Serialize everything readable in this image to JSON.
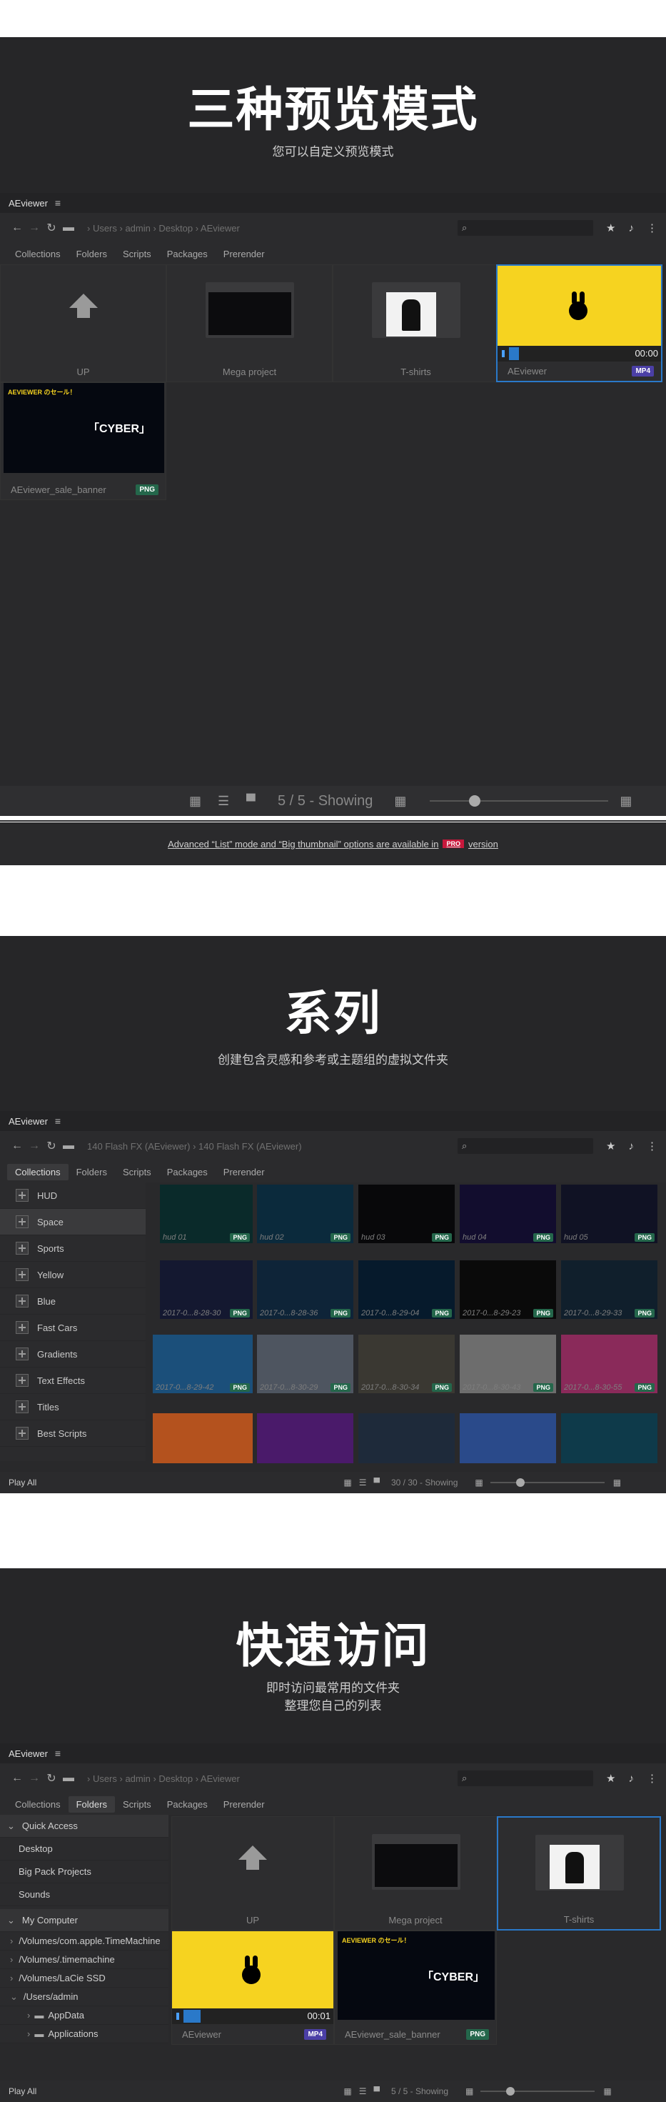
{
  "section1": {
    "title": "三种预览模式",
    "subtitle": "您可以自定义预览模式",
    "app_title": "AEviewer",
    "nav_crumbs": "›  Users  ›  admin  ›  Desktop  ›  AEviewer",
    "tabs": [
      "Collections",
      "Folders",
      "Scripts",
      "Packages",
      "Prerender"
    ],
    "cards": [
      {
        "label": "UP"
      },
      {
        "label": "Mega project"
      },
      {
        "label": "T-shirts"
      },
      {
        "label": "AEviewer",
        "badge": "MP4",
        "time": "00:00"
      },
      {
        "label": "AEviewer_sale_banner",
        "badge": "PNG"
      }
    ],
    "banner_text": "AEVIEWER のセール！",
    "banner_big": "「CYBER」",
    "status": "5 / 5 - Showing",
    "promo_before": "Advanced “List” mode and “Big thumbnail” options are available in",
    "promo_pro": "PRO",
    "promo_after": "version"
  },
  "section2": {
    "title": "系列",
    "subtitle": "创建包含灵感和参考或主题组的虚拟文件夹",
    "app_title": "AEviewer",
    "nav_crumbs": "140 Flash FX (AEviewer)  ›  140 Flash FX (AEviewer)",
    "tabs": [
      "Collections",
      "Folders",
      "Scripts",
      "Packages",
      "Prerender"
    ],
    "collections": [
      "HUD",
      "Space",
      "Sports",
      "Yellow",
      "Blue",
      "Fast Cars",
      "Gradients",
      "Text Effects",
      "Titles",
      "Best Scripts"
    ],
    "tiles_row1": [
      "hud 01",
      "hud 02",
      "hud 03",
      "hud 04",
      "hud 05"
    ],
    "tiles_row2": [
      "2017-0...8-28-30",
      "2017-0...8-28-36",
      "2017-0...8-29-04",
      "2017-0...8-29-23",
      "2017-0...8-29-33"
    ],
    "tiles_row3": [
      "2017-0...8-29-42",
      "2017-0...8-30-29",
      "2017-0...8-30-34",
      "2017-0...8-30-43",
      "2017-0...8-30-55"
    ],
    "badge": "PNG",
    "play_all": "Play All",
    "status": "30 / 30 - Showing"
  },
  "section3": {
    "title": "快速访问",
    "subtitle1": "即时访问最常用的文件夹",
    "subtitle2": "整理您自己的列表",
    "app_title": "AEviewer",
    "nav_crumbs": "›  Users  ›  admin  ›  Desktop  ›  AEviewer",
    "tabs": [
      "Collections",
      "Folders",
      "Scripts",
      "Packages",
      "Prerender"
    ],
    "quick_access_header": "Quick Access",
    "quick_access": [
      "Desktop",
      "Big Pack Projects",
      "Sounds"
    ],
    "my_computer_header": "My Computer",
    "computer": [
      "/Volumes/com.apple.TimeMachine",
      "/Volumes/.timemachine",
      "/Volumes/LaCie SSD",
      "/Users/admin",
      "AppData",
      "Applications"
    ],
    "cards": [
      {
        "label": "UP"
      },
      {
        "label": "Mega project"
      },
      {
        "label": "T-shirts"
      },
      {
        "label": "AEviewer",
        "badge": "MP4",
        "time": "00:01"
      },
      {
        "label": "AEviewer_sale_banner",
        "badge": "PNG"
      }
    ],
    "banner_text": "AEVIEWER のセール！",
    "banner_big": "「CYBER」",
    "play_all": "Play All",
    "status": "5 / 5 - Showing"
  },
  "colors": {
    "accent": "#2a79c9",
    "png_badge": "#24674b",
    "mp4_badge": "#4b3fa6",
    "pro": "#c8183c",
    "yellow": "#f6d320"
  }
}
